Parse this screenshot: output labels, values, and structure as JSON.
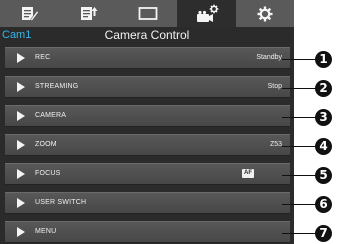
{
  "tabs": [
    {
      "name": "menu-list",
      "icon": "list-edit-icon",
      "active": false
    },
    {
      "name": "menu-settings",
      "icon": "list-up-icon",
      "active": false
    },
    {
      "name": "display",
      "icon": "monitor-icon",
      "active": false
    },
    {
      "name": "camera-control",
      "icon": "camera-gear-icon",
      "active": true
    },
    {
      "name": "settings",
      "icon": "gear-icon",
      "active": false
    }
  ],
  "header": {
    "camera_name": "Cam1",
    "title": "Camera Control"
  },
  "menu": [
    {
      "label": "REC",
      "value": "Standby",
      "callout": "1"
    },
    {
      "label": "STREAMING",
      "value": "Stop",
      "callout": "2"
    },
    {
      "label": "CAMERA",
      "value": "",
      "callout": "3"
    },
    {
      "label": "ZOOM",
      "value": "Z53",
      "callout": "4"
    },
    {
      "label": "FOCUS",
      "value": "",
      "badge": "AF",
      "callout": "5"
    },
    {
      "label": "USER SWITCH",
      "value": "",
      "callout": "6"
    },
    {
      "label": "MENU",
      "value": "",
      "callout": "7"
    }
  ],
  "colors": {
    "accent": "#35b6ea",
    "panel_bg": "#2b2b2b",
    "tabbar_bg": "#5a5a5a",
    "button_bg": "#505050"
  }
}
